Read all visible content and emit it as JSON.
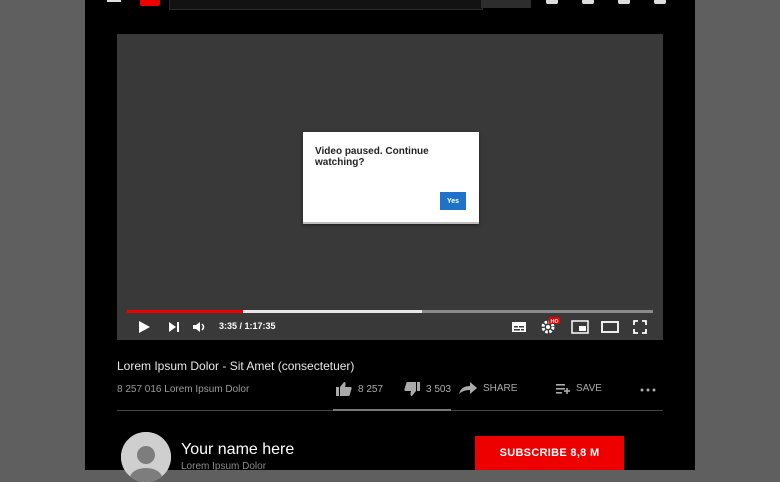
{
  "dialog": {
    "message": "Video paused. Continue watching?",
    "confirm_label": "Yes"
  },
  "player": {
    "time_display": "3:35 / 1:17:35",
    "played_fraction": 0.22,
    "buffered_fraction": 0.56,
    "hd_badge": "HD",
    "colors": {
      "played": "#ee0000",
      "buffer": "#e8e8e8",
      "track": "#8a8a8a"
    }
  },
  "video": {
    "title": "Lorem Ipsum Dolor - Sit Amet (consectetuer)",
    "views": "8 257 016 Lorem Ipsum Dolor",
    "likes": "8 257",
    "dislikes": "3 503",
    "share_label": "SHARE",
    "save_label": "SAVE"
  },
  "channel": {
    "name": "Your name here",
    "subtitle": "Lorem Ipsum Dolor",
    "subscribe_label": "SUBSCRIBE  8,8 M"
  },
  "icons": [
    "menu-icon",
    "logo-icon",
    "search-icon",
    "create-icon",
    "apps-icon",
    "notifications-icon",
    "play-icon",
    "next-icon",
    "volume-icon",
    "subtitles-icon",
    "settings-icon",
    "miniplayer-icon",
    "theater-icon",
    "fullscreen-icon",
    "like-icon",
    "dislike-icon",
    "share-icon",
    "save-icon",
    "more-icon"
  ]
}
